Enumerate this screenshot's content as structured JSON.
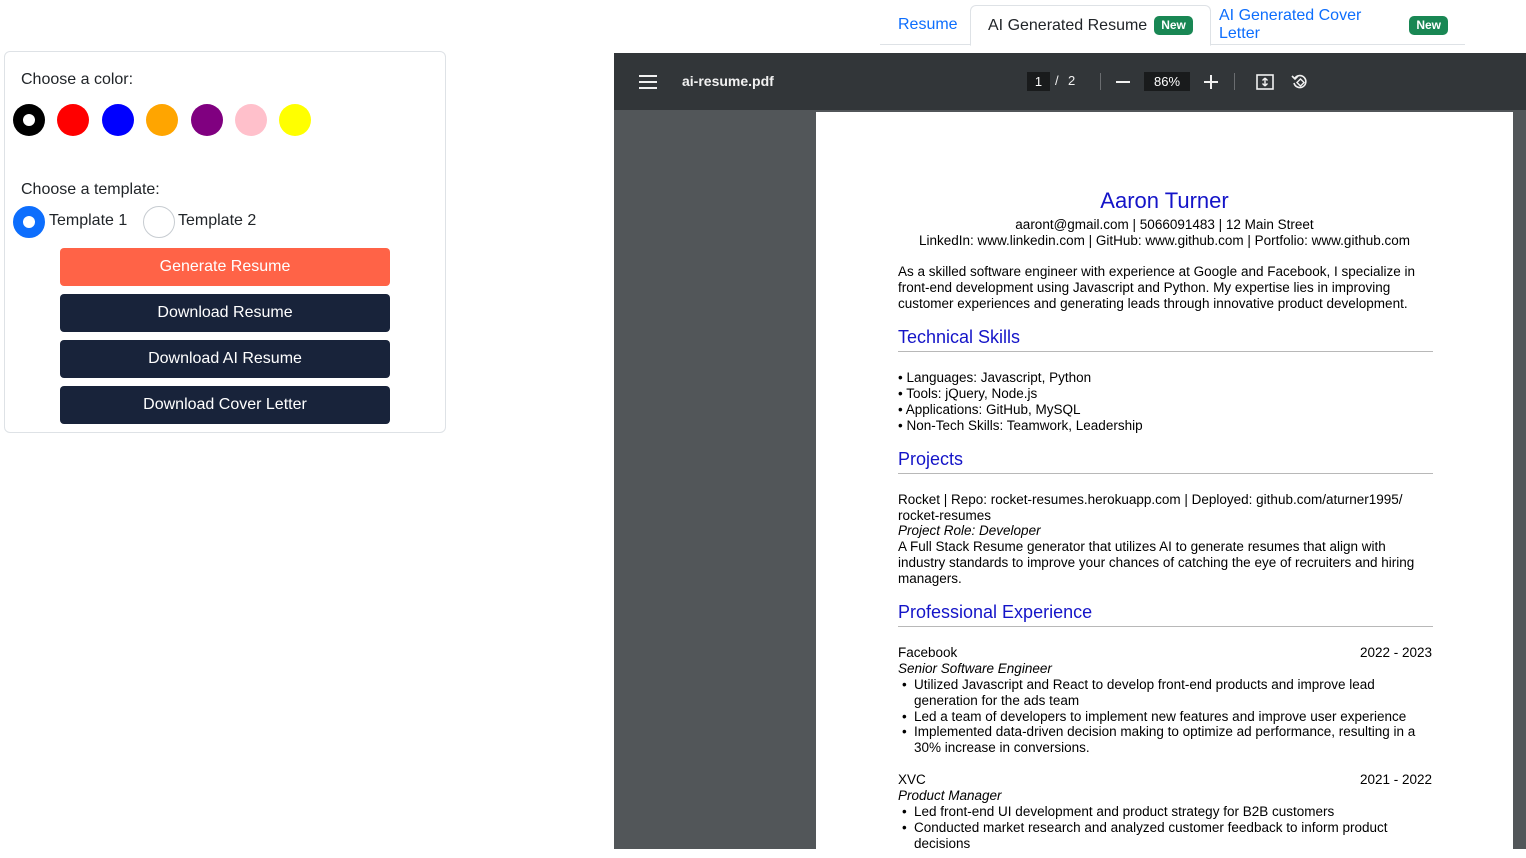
{
  "tabs": [
    {
      "label": "Resume",
      "badge": ""
    },
    {
      "label": "AI Generated Resume",
      "badge": "New"
    },
    {
      "label": "AI Generated Cover Letter",
      "badge": "New"
    }
  ],
  "controls": {
    "color_label": "Choose a color:",
    "colors": [
      "#000000",
      "#ff0000",
      "#0000ff",
      "#ffa500",
      "#800080",
      "#ffc0cb",
      "#ffff00"
    ],
    "selected_color": "#000000",
    "template_label": "Choose a template:",
    "templates": [
      "Template 1",
      "Template 2"
    ],
    "selected_template": "Template 1",
    "buttons": {
      "generate": "Generate Resume",
      "download_resume": "Download Resume",
      "download_ai_resume": "Download AI Resume",
      "download_cover_letter": "Download Cover Letter"
    }
  },
  "viewer": {
    "filename": "ai-resume.pdf",
    "current_page": "1",
    "page_separator": "/",
    "total_pages": "2",
    "zoom": "86%",
    "icons": {
      "menu": "hamburger-icon",
      "zoom_out": "minus-icon",
      "zoom_in": "plus-icon",
      "fit": "fit-page-icon",
      "rotate": "rotate-icon"
    }
  },
  "resume": {
    "name": "Aaron Turner",
    "contact_line1": "aaront@gmail.com | 5066091483 | 12 Main Street",
    "contact_line2": "LinkedIn: www.linkedin.com | GitHub: www.github.com | Portfolio: www.github.com",
    "summary": [
      "As a skilled software engineer with experience at Google and Facebook, I specialize in",
      "front-end development using Javascript and Python. My expertise lies in improving",
      "customer experiences and generating leads through innovative product development."
    ],
    "skills_heading": "Technical Skills",
    "skills": [
      "• Languages: Javascript, Python",
      "• Tools: jQuery, Node.js",
      "• Applications: GitHub, MySQL",
      "• Non-Tech Skills: Teamwork, Leadership"
    ],
    "projects_heading": "Projects",
    "project": {
      "line1": "Rocket | Repo: rocket-resumes.herokuapp.com | Deployed: github.com/aturner1995/",
      "line2": "rocket-resumes",
      "role": "Project Role: Developer",
      "desc": [
        "A Full Stack Resume generator that utilizes AI to generate resumes that align with",
        "industry standards to improve your chances of catching the eye of recruiters and hiring",
        "managers."
      ]
    },
    "experience_heading": "Professional Experience",
    "jobs": [
      {
        "company": "Facebook",
        "dates": "2022 - 2023",
        "title": "Senior Software Engineer",
        "bullets": [
          "Utilized Javascript and React to develop front-end products and improve lead",
          "generation for the ads team",
          "Led a team of developers to implement new features and improve user experience",
          "Implemented data-driven decision making to optimize ad performance, resulting in a",
          "30% increase in conversions."
        ]
      },
      {
        "company": "XVC",
        "dates": "2021 - 2022",
        "title": "Product Manager",
        "bullets": [
          "Led front-end UI development and product strategy for B2B customers",
          "Conducted market research and analyzed customer feedback to inform product",
          "decisions"
        ]
      }
    ]
  }
}
